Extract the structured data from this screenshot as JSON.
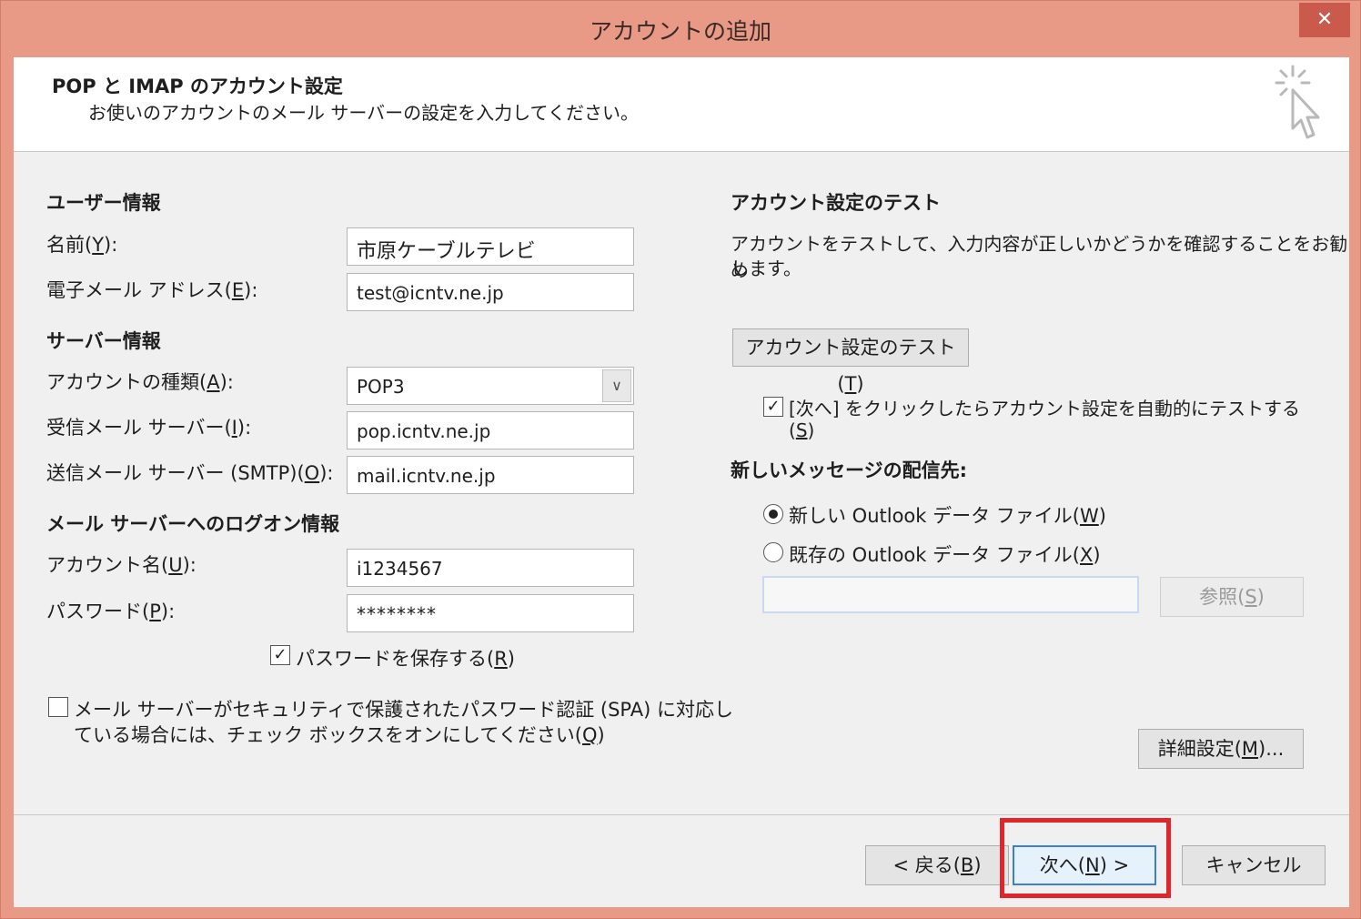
{
  "window": {
    "title": "アカウントの追加",
    "close_glyph": "✕"
  },
  "header": {
    "title": "POP と IMAP のアカウント設定",
    "subtitle": "お使いのアカウントのメール サーバーの設定を入力してください。",
    "icon": "wizard-cursor-icon"
  },
  "user_info": {
    "heading": "ユーザー情報",
    "name_label": "名前(",
    "name_key": "Y",
    "name_suffix": "):",
    "name_value": "市原ケーブルテレビ",
    "email_label": "電子メール アドレス(",
    "email_key": "E",
    "email_suffix": "):",
    "email_value": "test@icntv.ne.jp"
  },
  "server_info": {
    "heading": "サーバー情報",
    "type_label": "アカウントの種類(",
    "type_key": "A",
    "type_suffix": "):",
    "type_value": "POP3",
    "incoming_label": "受信メール サーバー(",
    "incoming_key": "I",
    "incoming_suffix": "):",
    "incoming_value": "pop.icntv.ne.jp",
    "outgoing_label": "送信メール サーバー (SMTP)(",
    "outgoing_key": "O",
    "outgoing_suffix": "):",
    "outgoing_value": "mail.icntv.ne.jp"
  },
  "logon_info": {
    "heading": "メール サーバーへのログオン情報",
    "account_label": "アカウント名(",
    "account_key": "U",
    "account_suffix": "):",
    "account_value": "i1234567",
    "password_label": "パスワード(",
    "password_key": "P",
    "password_suffix": "):",
    "password_value": "********",
    "save_password_label": "パスワードを保存する(",
    "save_password_key": "R",
    "save_password_suffix": ")",
    "save_password_checked": true,
    "spa_line1": "メール サーバーがセキュリティで保護されたパスワード認証 (SPA) に対応し",
    "spa_line2": "ている場合には、チェック ボックスをオンにしてください(",
    "spa_key": "Q",
    "spa_suffix": ")",
    "spa_checked": false
  },
  "test_section": {
    "heading": "アカウント設定のテスト",
    "desc_line1": "アカウントをテストして、入力内容が正しいかどうかを確認することをお勧め",
    "desc_line2": "します。",
    "test_button_label": "アカウント設定のテスト(",
    "test_button_key": "T",
    "test_button_suffix": ")",
    "auto_test_line1": "[次へ] をクリックしたらアカウント設定を自動的にテストする",
    "auto_test_key": "S",
    "auto_test_checked": true
  },
  "delivery": {
    "heading": "新しいメッセージの配信先:",
    "new_file_label": "新しい Outlook データ ファイル(",
    "new_file_key": "W",
    "new_file_suffix": ")",
    "existing_file_label": "既存の Outlook データ ファイル(",
    "existing_file_key": "X",
    "existing_file_suffix": ")",
    "selected": "new",
    "browse_label": "参照(",
    "browse_key": "S",
    "browse_suffix": ")"
  },
  "advanced_button": {
    "label": "詳細設定(",
    "key": "M",
    "suffix": ")..."
  },
  "footer": {
    "back_label": "< 戻る(",
    "back_key": "B",
    "back_suffix": ")",
    "next_label": "次へ(",
    "next_key": "N",
    "next_suffix": ") >",
    "cancel_label": "キャンセル"
  },
  "colors": {
    "titlebar": "#e99a87",
    "close_button": "#c95a4c",
    "highlight": "#e0262a"
  }
}
